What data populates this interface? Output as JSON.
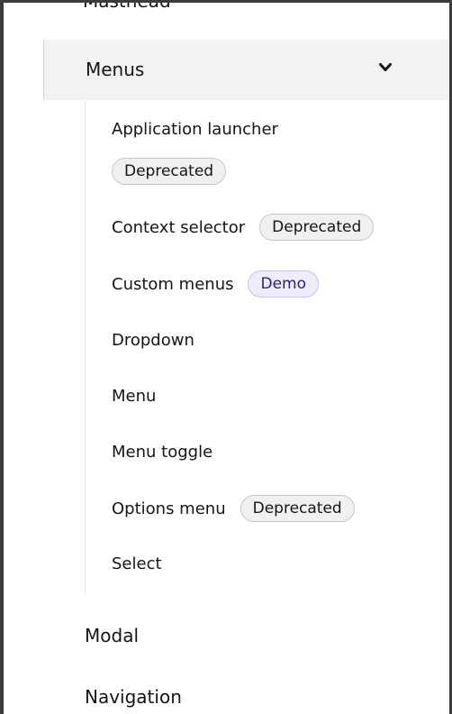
{
  "nav": {
    "previous_item": "Masthead",
    "expanded_group": {
      "label": "Menus",
      "icon": "chevron-down-icon",
      "items": [
        {
          "label": "Application launcher",
          "badge": "Deprecated"
        },
        {
          "label": "Context selector",
          "badge": "Deprecated"
        },
        {
          "label": "Custom menus",
          "badge": "Demo"
        },
        {
          "label": "Dropdown"
        },
        {
          "label": "Menu"
        },
        {
          "label": "Menu toggle"
        },
        {
          "label": "Options menu",
          "badge": "Deprecated"
        },
        {
          "label": "Select"
        }
      ]
    },
    "following_items": [
      "Modal",
      "Navigation"
    ]
  },
  "colors": {
    "expanded_background": "#f2f2f2",
    "deprecated_badge": "#f0f0f0",
    "demo_badge": "#f0ecfb",
    "frame_border": "#3c3c3c"
  }
}
